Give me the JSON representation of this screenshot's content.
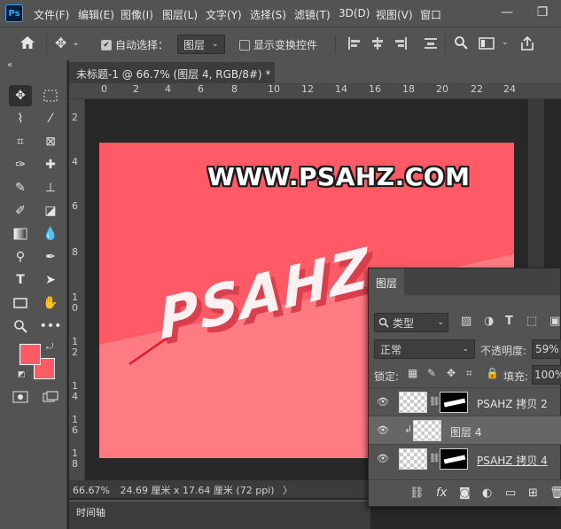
{
  "app": {
    "logo": "Ps"
  },
  "menu": [
    "文件(F)",
    "编辑(E)",
    "图像(I)",
    "图层(L)",
    "文字(Y)",
    "选择(S)",
    "滤镜(T)",
    "3D(D)",
    "视图(V)",
    "窗口"
  ],
  "window_controls": {
    "minimize": "—",
    "restore": "❐"
  },
  "options": {
    "home_icon": "home-icon",
    "auto_select_label": "自动选择：",
    "auto_select_checked": true,
    "auto_select_value": "图层",
    "show_transform_label": "显示变换控件",
    "show_transform_checked": false
  },
  "document": {
    "tab_title": "未标题-1 @ 66.7% (图层 4, RGB/8#) *",
    "close": "×",
    "zoom": "66.67%",
    "size_info": "24.69 厘米 x 17.64 厘米 (72 ppi)",
    "status_arrow": "〉"
  },
  "ruler": {
    "h": [
      "0",
      "2",
      "4",
      "6",
      "8",
      "10",
      "12",
      "14",
      "16",
      "18",
      "20",
      "22",
      "24"
    ],
    "v": [
      "2",
      "4",
      "6",
      "8",
      "1\n0",
      "1\n2",
      "1\n4",
      "1\n6",
      "1\n8"
    ]
  },
  "canvas": {
    "watermark": "WWW.PSAHZ.COM",
    "big_text": "PSAHZ",
    "background_color": "#ff5a65",
    "lower_band_color": "#ff7b84"
  },
  "timeline_label": "时间轴",
  "colors": {
    "foreground": "#ff5a65",
    "background": "#ff5a65"
  },
  "layers_panel": {
    "tab": "图层",
    "filter_kind": "类型",
    "blend_mode": "正常",
    "opacity_label": "不透明度:",
    "opacity_value": "59%",
    "lock_label": "锁定:",
    "fill_label": "填充:",
    "fill_value": "100%",
    "layers": [
      {
        "name": "PSAHZ 拷贝 2",
        "has_mask": true,
        "selected": false
      },
      {
        "name": "图层 4",
        "has_mask": false,
        "selected": true
      },
      {
        "name": "PSAHZ 拷贝 4",
        "has_mask": true,
        "selected": false
      }
    ],
    "footer_fx": "fx"
  }
}
